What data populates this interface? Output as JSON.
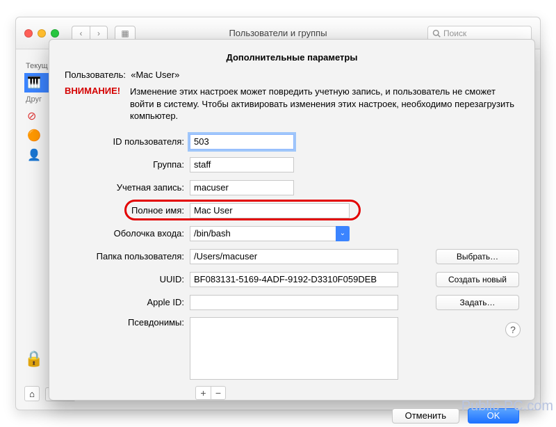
{
  "parent": {
    "title": "Пользователи и группы",
    "search_placeholder": "Поиск",
    "sidebar": {
      "current_label": "Текущ",
      "others_label": "Друг"
    }
  },
  "sheet": {
    "title": "Дополнительные параметры",
    "user_prefix": "Пользователь:",
    "user_name": "«Mac User»",
    "warning_label": "ВНИМАНИЕ!",
    "warning_text": "Изменение этих настроек может повредить учетную запись, и пользователь не сможет войти в систему. Чтобы активировать изменения этих настроек, необходимо перезагрузить компьютер.",
    "fields": {
      "user_id": {
        "label": "ID пользователя:",
        "value": "503"
      },
      "group": {
        "label": "Группа:",
        "value": "staff"
      },
      "account": {
        "label": "Учетная запись:",
        "value": "macuser"
      },
      "full_name": {
        "label": "Полное имя:",
        "value": "Mac User"
      },
      "login_shell": {
        "label": "Оболочка входа:",
        "value": "/bin/bash"
      },
      "home_dir": {
        "label": "Папка пользователя:",
        "value": "/Users/macuser",
        "button": "Выбрать…"
      },
      "uuid": {
        "label": "UUID:",
        "value": "BF083131-5169-4ADF-9192-D3310F059DEB",
        "button": "Создать новый"
      },
      "apple_id": {
        "label": "Apple ID:",
        "value": "",
        "button": "Задать…"
      },
      "aliases": {
        "label": "Псевдонимы:"
      }
    },
    "buttons": {
      "cancel": "Отменить",
      "ok": "OK"
    }
  },
  "watermark": "Public-PC.com"
}
